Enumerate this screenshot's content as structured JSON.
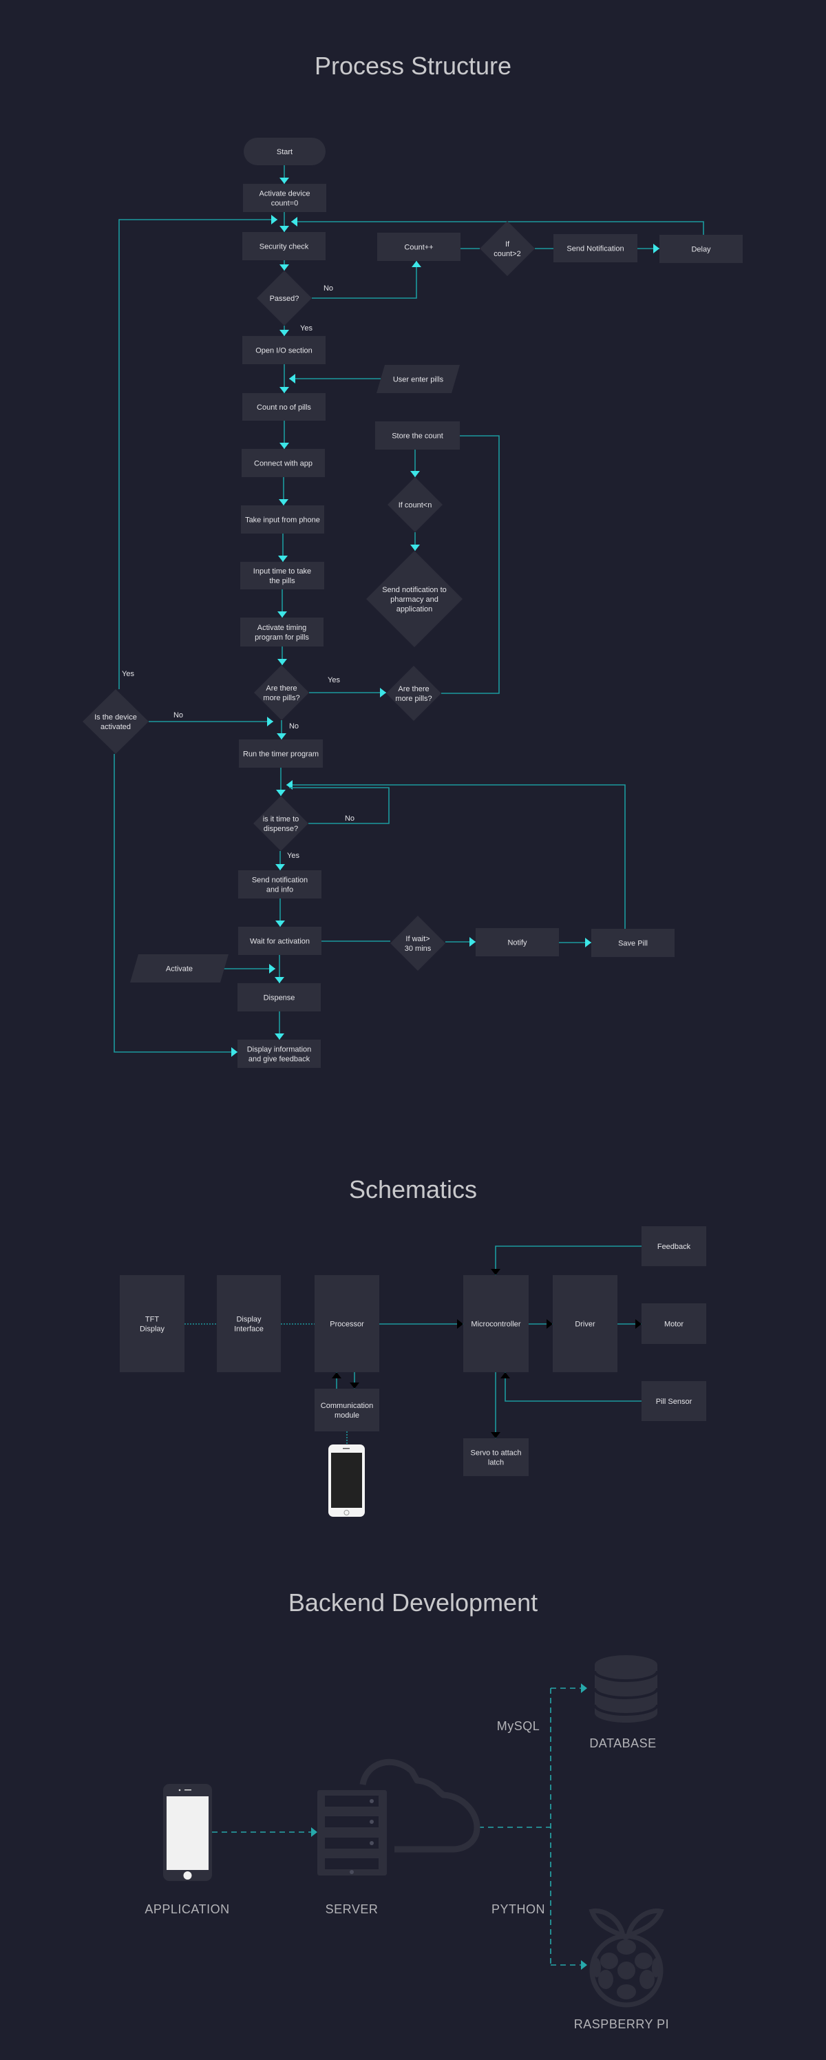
{
  "titles": {
    "process": "Process Structure",
    "schematics": "Schematics",
    "backend": "Backend Development"
  },
  "flow": {
    "nodes": {
      "start": [
        "Start"
      ],
      "activate_device": [
        "Activate device",
        "count=0"
      ],
      "security_check": [
        "Security check"
      ],
      "count_inc": [
        "Count++"
      ],
      "if_count_gt2": [
        "If",
        "count>2"
      ],
      "send_notification": [
        "Send Notification"
      ],
      "delay": [
        "Delay"
      ],
      "passed": [
        "Passed?"
      ],
      "open_io": [
        "Open I/O section"
      ],
      "user_enter_pills": [
        "User enter pills"
      ],
      "count_pills": [
        "Count no of pills"
      ],
      "store_count": [
        "Store the count"
      ],
      "connect_app": [
        "Connect with app"
      ],
      "if_count_lt_n": [
        "If count<n"
      ],
      "take_input": [
        "Take input from phone"
      ],
      "input_time": [
        "Input time to take",
        "the pills"
      ],
      "notify_pharmacy": [
        "Send notification to",
        "pharmacy and",
        "application"
      ],
      "activate_timing": [
        "Activate timing",
        "program for pills"
      ],
      "more_pills_left": [
        "Are there",
        "more pills?"
      ],
      "more_pills_right": [
        "Are there",
        "more pills?"
      ],
      "device_activated": [
        "Is the device",
        "activated"
      ],
      "run_timer": [
        "Run the timer program"
      ],
      "time_to_dispense": [
        "is it time to",
        "dispense?"
      ],
      "send_notif_info": [
        "Send notification",
        "and info"
      ],
      "wait_activation": [
        "Wait for activation"
      ],
      "if_wait": [
        "If wait>",
        "30 mins"
      ],
      "notify": [
        "Notify"
      ],
      "save_pill": [
        "Save Pill"
      ],
      "activate_input": [
        "Activate"
      ],
      "dispense": [
        "Dispense"
      ],
      "display_info": [
        "Display information",
        "and give feedback"
      ]
    },
    "labels": [
      "No",
      "Yes",
      "Yes",
      "No",
      "Yes",
      "No",
      "No",
      "Yes"
    ]
  },
  "schematics": {
    "nodes": {
      "tft_display": [
        "TFT",
        "Display"
      ],
      "display_interface": [
        "Display",
        "Interface"
      ],
      "processor": [
        "Processor"
      ],
      "microcontroller": [
        "Microcontroller"
      ],
      "driver": [
        "Driver"
      ],
      "feedback": [
        "Feedback"
      ],
      "motor": [
        "Motor"
      ],
      "pill_sensor": [
        "Pill Sensor"
      ],
      "communication_module": [
        "Communication",
        "module"
      ],
      "servo": [
        "Servo to attach",
        "latch"
      ]
    }
  },
  "backend": {
    "labels": {
      "application": "APPLICATION",
      "server": "SERVER",
      "mysql": "MySQL",
      "python": "PYTHON",
      "database": "DATABASE",
      "raspberry_pi": "RASPBERRY PI"
    },
    "icons": [
      "phone-icon",
      "server-icon",
      "cloud-icon",
      "database-icon",
      "raspberry-pi-icon"
    ]
  },
  "colors": {
    "background": "#1e1f2e",
    "box": "#2e2f3c",
    "line": "#1b9a9e",
    "arrow": "#3de6e8",
    "title": "#c9c9cc"
  }
}
